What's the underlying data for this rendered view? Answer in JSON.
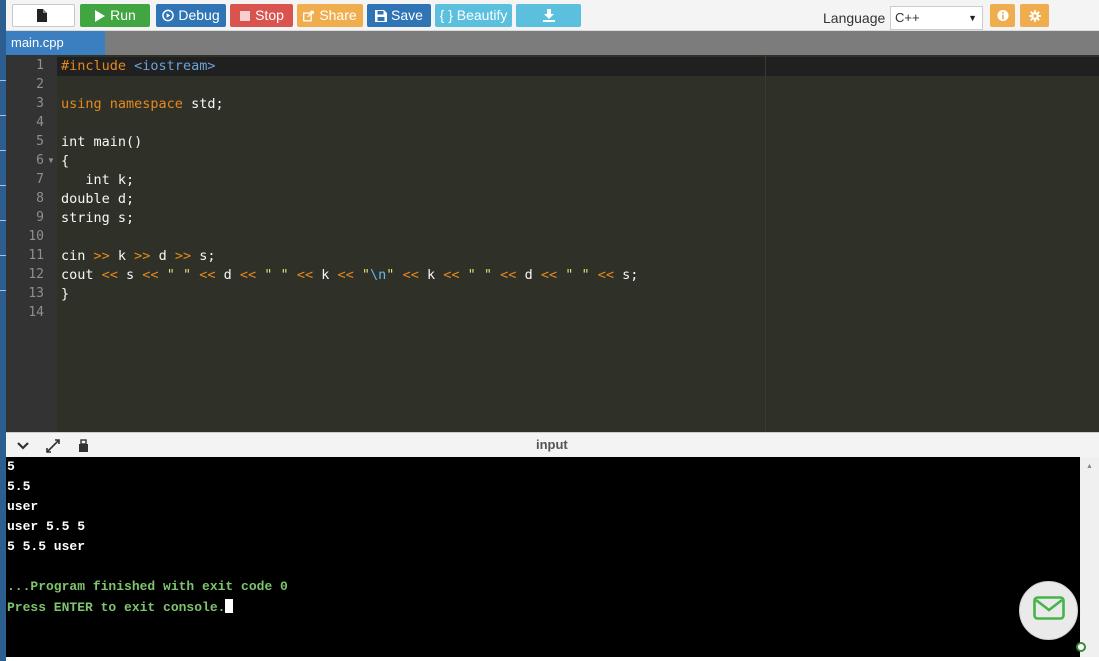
{
  "toolbar": {
    "new_label": "",
    "run_label": "Run",
    "debug_label": "Debug",
    "stop_label": "Stop",
    "share_label": "Share",
    "save_label": "Save",
    "beautify_label": "{ } Beautify",
    "language_label": "Language",
    "language_value": "C++",
    "icons": [
      "file-icon",
      "play-icon",
      "debug-icon",
      "stop-icon",
      "share-icon",
      "save-icon",
      "download-icon",
      "info-icon",
      "gear-icon"
    ]
  },
  "tabs": [
    {
      "label": "main.cpp",
      "active": true
    }
  ],
  "editor": {
    "line_numbers": [
      "1",
      "2",
      "3",
      "4",
      "5",
      "6",
      "7",
      "8",
      "9",
      "10",
      "11",
      "12",
      "13",
      "14"
    ],
    "lines": [
      "#include <iostream>",
      "",
      "using namespace std;",
      "",
      "int main()",
      "{",
      "   int k;",
      "double d;",
      "string s;",
      "",
      "cin >> k >> d >> s;",
      "cout << s << \" \" << d << \" \" << k << \"\\n\" << k << \" \" << d << \" \" << s;",
      "}",
      ""
    ],
    "active_line": 1
  },
  "console": {
    "title": "input",
    "icons": [
      "chevron-down-icon",
      "expand-icon",
      "input-mode-icon"
    ],
    "output_lines": [
      "5",
      "5.5",
      "user",
      "user 5.5 5",
      "5 5.5 user",
      ""
    ],
    "status_lines": [
      "...Program finished with exit code 0",
      "Press ENTER to exit console."
    ]
  },
  "colors": {
    "run": "#41a541",
    "debug": "#2f74b5",
    "stop": "#d9534f",
    "share": "#f0ad4e",
    "save": "#2f74b5",
    "beautify": "#5bc0de",
    "editor_bg": "#2f3129",
    "console_bg": "#000000",
    "status_green": "#7ec46d"
  }
}
